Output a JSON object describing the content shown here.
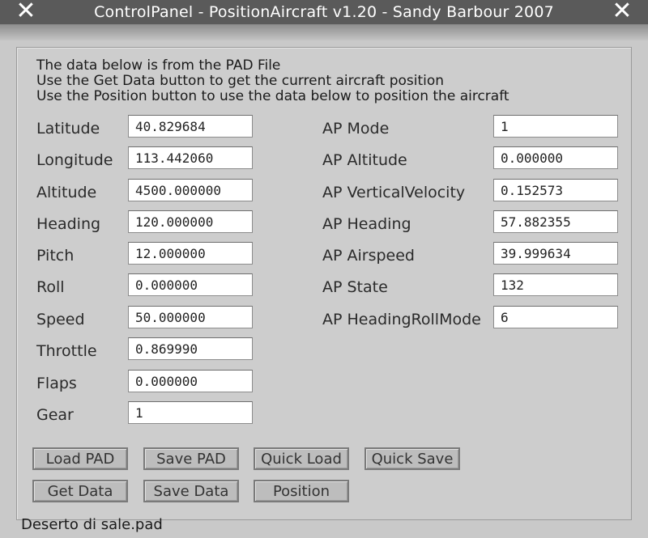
{
  "window": {
    "title": "ControlPanel - PositionAircraft v1.20 - Sandy Barbour 2007",
    "close_left": "✕",
    "close_right": "✕"
  },
  "info": {
    "line1": "The data below is from the PAD File",
    "line2": "Use the Get Data button to get the current aircraft position",
    "line3": "Use the Position button to use the data below to position the aircraft"
  },
  "left_fields": [
    {
      "label": "Latitude",
      "value": "40.829684"
    },
    {
      "label": "Longitude",
      "value": "113.442060"
    },
    {
      "label": "Altitude",
      "value": "4500.000000"
    },
    {
      "label": "Heading",
      "value": "120.000000"
    },
    {
      "label": "Pitch",
      "value": "12.000000"
    },
    {
      "label": "Roll",
      "value": "0.000000"
    },
    {
      "label": "Speed",
      "value": "50.000000"
    },
    {
      "label": "Throttle",
      "value": "0.869990"
    },
    {
      "label": "Flaps",
      "value": "0.000000"
    },
    {
      "label": "Gear",
      "value": "1"
    }
  ],
  "right_fields": [
    {
      "label": "AP Mode",
      "value": "1"
    },
    {
      "label": "AP Altitude",
      "value": "0.000000"
    },
    {
      "label": "AP VerticalVelocity",
      "value": "0.152573"
    },
    {
      "label": "AP Heading",
      "value": "57.882355"
    },
    {
      "label": "AP Airspeed",
      "value": "39.999634"
    },
    {
      "label": "AP State",
      "value": "132"
    },
    {
      "label": "AP HeadingRollMode",
      "value": "6"
    }
  ],
  "buttons": {
    "load_pad": "Load PAD",
    "save_pad": "Save PAD",
    "quick_load": "Quick Load",
    "quick_save": "Quick Save",
    "get_data": "Get Data",
    "save_data": "Save Data",
    "position": "Position"
  },
  "status": {
    "filename": "Deserto di sale.pad"
  },
  "colors": {
    "titlebar": "#5a5a5a",
    "panel": "#cdcdcd",
    "button": "#bdbdbd",
    "field": "#ffffff"
  }
}
